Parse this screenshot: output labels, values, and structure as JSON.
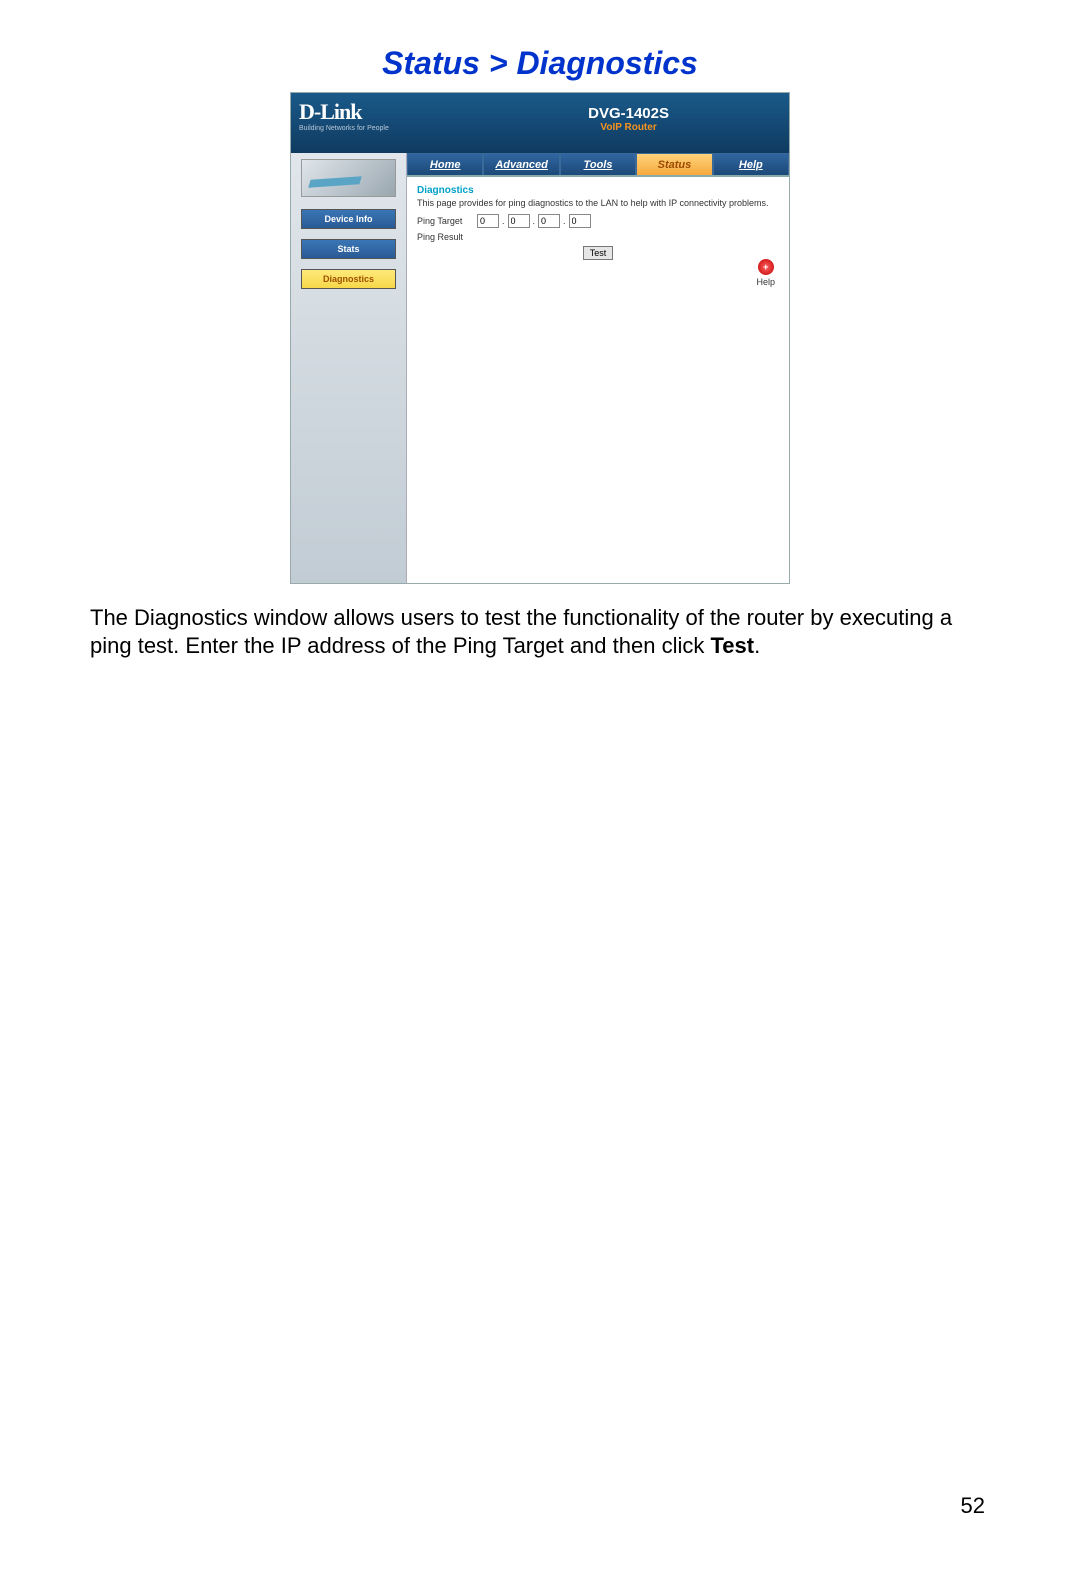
{
  "page": {
    "title": "Status > Diagnostics",
    "number": "52"
  },
  "header": {
    "logo": "D-Link",
    "tagline": "Building Networks for People",
    "model": "DVG-1402S",
    "model_sub": "VoIP Router"
  },
  "tabs": {
    "home": "Home",
    "advanced": "Advanced",
    "tools": "Tools",
    "status": "Status",
    "help": "Help"
  },
  "sidebar": {
    "device_info": "Device Info",
    "stats": "Stats",
    "diagnostics": "Diagnostics"
  },
  "content": {
    "section_title": "Diagnostics",
    "description": "This page provides for ping diagnostics to the LAN to help with IP connectivity problems.",
    "ping_target_label": "Ping Target",
    "ping_result_label": "Ping Result",
    "ip": {
      "a": "0",
      "b": "0",
      "c": "0",
      "d": "0"
    },
    "test_button": "Test",
    "help_label": "Help"
  },
  "doc": {
    "text_before": "The Diagnostics window allows users to test the functionality of the router by executing a ping test. Enter the IP address of the Ping Target and then click ",
    "bold": "Test",
    "text_after": "."
  }
}
